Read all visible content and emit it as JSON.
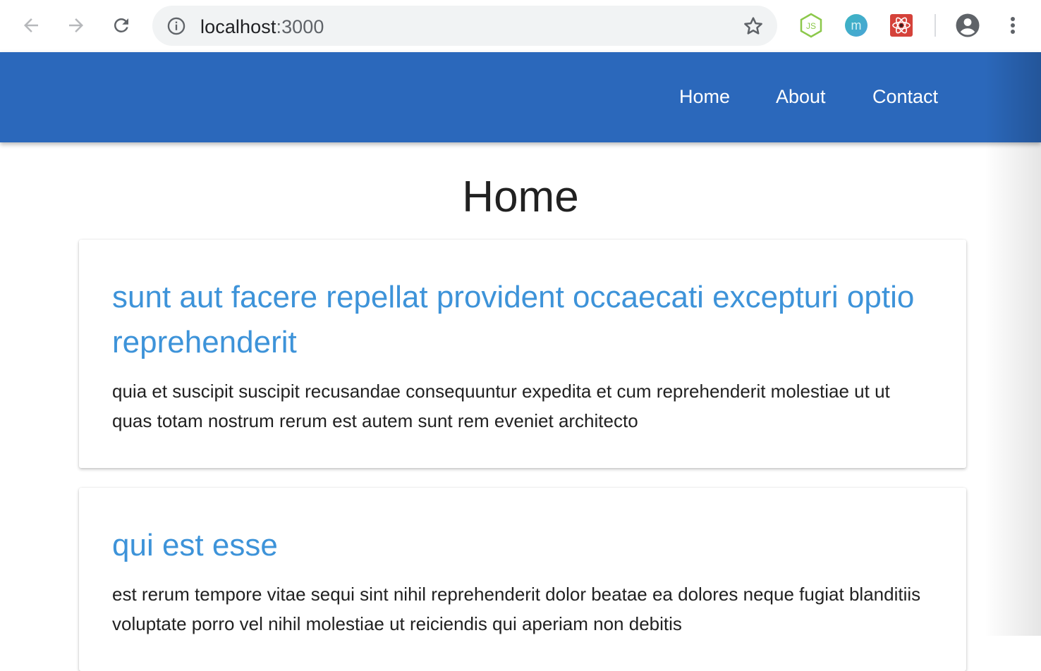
{
  "browser": {
    "url_host": "localhost",
    "url_port": ":3000",
    "icons": {
      "back": "arrow-left-icon",
      "forward": "arrow-right-icon",
      "reload": "reload-icon",
      "info": "info-icon",
      "bookmark": "star-icon",
      "ext_node": "nodejs-extension-icon",
      "ext_m": "m-extension-icon",
      "ext_react": "react-devtools-icon",
      "profile": "account-icon",
      "menu": "kebab-menu-icon"
    },
    "ext_m_letter": "m",
    "ext_node_letters": "JS"
  },
  "header": {
    "nav": [
      {
        "label": "Home"
      },
      {
        "label": "About"
      },
      {
        "label": "Contact"
      }
    ],
    "color": "#2b68bb"
  },
  "main": {
    "title": "Home",
    "posts": [
      {
        "title": "sunt aut facere repellat provident occaecati excepturi optio reprehenderit",
        "body": "quia et suscipit suscipit recusandae consequuntur expedita et cum reprehenderit molestiae ut ut quas totam nostrum rerum est autem sunt rem eveniet architecto"
      },
      {
        "title": "qui est esse",
        "body": "est rerum tempore vitae sequi sint nihil reprehenderit dolor beatae ea dolores neque fugiat blanditiis voluptate porro vel nihil molestiae ut reiciendis qui aperiam non debitis"
      }
    ],
    "link_color": "#3d93d9"
  }
}
